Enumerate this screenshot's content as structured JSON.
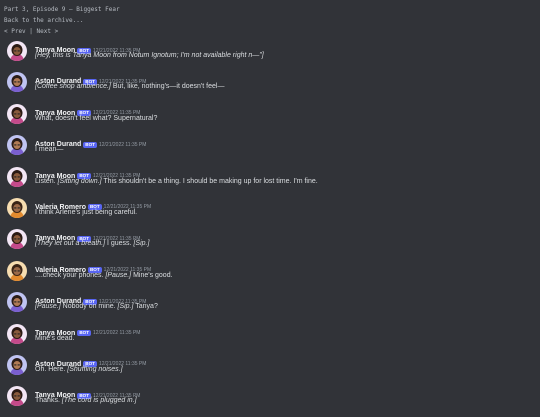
{
  "header": {
    "episode_title": "Part 3, Episode 9 — Biggest Fear",
    "back_link": "Back to the archive...",
    "prev_label": "< Prev",
    "separator": " | ",
    "next_label": "Next >"
  },
  "messages": [
    {
      "author": "Tanya Moon",
      "avatar": "tanya",
      "badge": "BOT",
      "time": "12/21/2022 11:35 PM",
      "parts": [
        {
          "t": "[Hey, this is Tanya Moon from Notum Ignotum; I'm not available right n—\"]",
          "i": true
        }
      ]
    },
    {
      "author": "Aston Durand",
      "avatar": "aston",
      "badge": "BOT",
      "time": "12/21/2022 11:35 PM",
      "parts": [
        {
          "t": "[Coffee shop ambience.]",
          "i": true
        },
        {
          "t": " But, like, nothing's—it doesn't feel—",
          "i": false
        }
      ]
    },
    {
      "author": "Tanya Moon",
      "avatar": "tanya",
      "badge": "BOT",
      "time": "12/21/2022 11:35 PM",
      "parts": [
        {
          "t": "What, doesn't feel what? Supernatural?",
          "i": false
        }
      ]
    },
    {
      "author": "Aston Durand",
      "avatar": "aston",
      "badge": "BOT",
      "time": "12/21/2022 11:35 PM",
      "parts": [
        {
          "t": "I mean—",
          "i": false
        }
      ]
    },
    {
      "author": "Tanya Moon",
      "avatar": "tanya",
      "badge": "BOT",
      "time": "12/21/2022 11:35 PM",
      "parts": [
        {
          "t": "Listen. ",
          "i": false
        },
        {
          "t": "[Sitting down.]",
          "i": true
        },
        {
          "t": " This shouldn't be a thing. I should be making up for lost time. I'm fine.",
          "i": false
        }
      ]
    },
    {
      "author": "Valeria Romero",
      "avatar": "valeria",
      "badge": "BOT",
      "time": "12/21/2022 11:35 PM",
      "parts": [
        {
          "t": "I think Arlene's just being careful.",
          "i": false
        }
      ]
    },
    {
      "author": "Tanya Moon",
      "avatar": "tanya",
      "badge": "BOT",
      "time": "12/21/2022 11:35 PM",
      "parts": [
        {
          "t": "[They let out a breath.]",
          "i": true
        },
        {
          "t": " I guess. ",
          "i": false
        },
        {
          "t": "[Sip.]",
          "i": true
        }
      ]
    },
    {
      "author": "Valeria Romero",
      "avatar": "valeria",
      "badge": "BOT",
      "time": "12/21/2022 11:35 PM",
      "parts": [
        {
          "t": "....check your phones. ",
          "i": false
        },
        {
          "t": "[Pause.]",
          "i": true
        },
        {
          "t": " Mine's good.",
          "i": false
        }
      ]
    },
    {
      "author": "Aston Durand",
      "avatar": "aston",
      "badge": "BOT",
      "time": "12/21/2022 11:35 PM",
      "parts": [
        {
          "t": "[Pause.]",
          "i": true
        },
        {
          "t": " Nobody on mine. ",
          "i": false
        },
        {
          "t": "[Sip.]",
          "i": true
        },
        {
          "t": " Tanya?",
          "i": false
        }
      ]
    },
    {
      "author": "Tanya Moon",
      "avatar": "tanya",
      "badge": "BOT",
      "time": "12/21/2022 11:35 PM",
      "parts": [
        {
          "t": "Mine's dead.",
          "i": false
        }
      ]
    },
    {
      "author": "Aston Durand",
      "avatar": "aston",
      "badge": "BOT",
      "time": "12/21/2022 11:35 PM",
      "parts": [
        {
          "t": "Oh. Here. ",
          "i": false
        },
        {
          "t": "[Shuffling noises.]",
          "i": true
        }
      ]
    },
    {
      "author": "Tanya Moon",
      "avatar": "tanya",
      "badge": "BOT",
      "time": "12/21/2022 11:35 PM",
      "parts": [
        {
          "t": "Thanks. ",
          "i": false
        },
        {
          "t": "[The cord is plugged in.]",
          "i": true
        }
      ]
    }
  ],
  "avatar_colors": {
    "tanya": {
      "bg": "#f3e6f5",
      "hair": "#2b1a14",
      "skin": "#8a5a3c",
      "accent": "#c44a8a"
    },
    "aston": {
      "bg": "#c0c4f2",
      "hair": "#2a1c18",
      "skin": "#b07a56",
      "accent": "#7a5fd0"
    },
    "valeria": {
      "bg": "#f7ddb0",
      "hair": "#3a2416",
      "skin": "#9c6a48",
      "accent": "#e28a2e"
    }
  },
  "colors": {
    "background": "#313338",
    "bot_badge": "#5865f2",
    "username": "#f2f3f5",
    "timestamp": "#949ba4",
    "text": "#dbdee1"
  }
}
